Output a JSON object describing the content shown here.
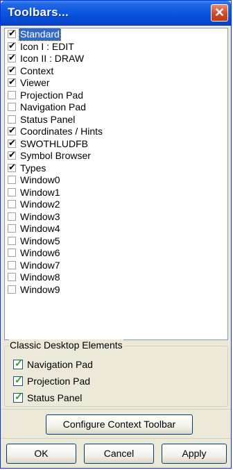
{
  "window": {
    "title": "Toolbars..."
  },
  "toolbars": [
    {
      "label": "Standard",
      "checked": true,
      "selected": true
    },
    {
      "label": "Icon I : EDIT",
      "checked": true
    },
    {
      "label": "Icon II : DRAW",
      "checked": true
    },
    {
      "label": "Context",
      "checked": true
    },
    {
      "label": "Viewer",
      "checked": true
    },
    {
      "label": "Projection Pad",
      "checked": false
    },
    {
      "label": "Navigation Pad",
      "checked": false
    },
    {
      "label": "Status Panel",
      "checked": false
    },
    {
      "label": "Coordinates / Hints",
      "checked": true
    },
    {
      "label": "SWOTHLUDFB",
      "checked": true
    },
    {
      "label": "Symbol Browser",
      "checked": true
    },
    {
      "label": "Types",
      "checked": true
    },
    {
      "label": "Window0",
      "checked": false
    },
    {
      "label": "Window1",
      "checked": false
    },
    {
      "label": "Window2",
      "checked": false
    },
    {
      "label": "Window3",
      "checked": false
    },
    {
      "label": "Window4",
      "checked": false
    },
    {
      "label": "Window5",
      "checked": false
    },
    {
      "label": "Window6",
      "checked": false
    },
    {
      "label": "Window7",
      "checked": false
    },
    {
      "label": "Window8",
      "checked": false
    },
    {
      "label": "Window9",
      "checked": false
    }
  ],
  "classic": {
    "label": "Classic Desktop Elements",
    "items": [
      {
        "label": "Navigation Pad",
        "checked": true
      },
      {
        "label": "Projection Pad",
        "checked": true
      },
      {
        "label": "Status Panel",
        "checked": true
      }
    ]
  },
  "buttons": {
    "configure": "Configure Context Toolbar",
    "ok": "OK",
    "cancel": "Cancel",
    "apply": "Apply"
  },
  "icons": {
    "close": "close-icon"
  }
}
